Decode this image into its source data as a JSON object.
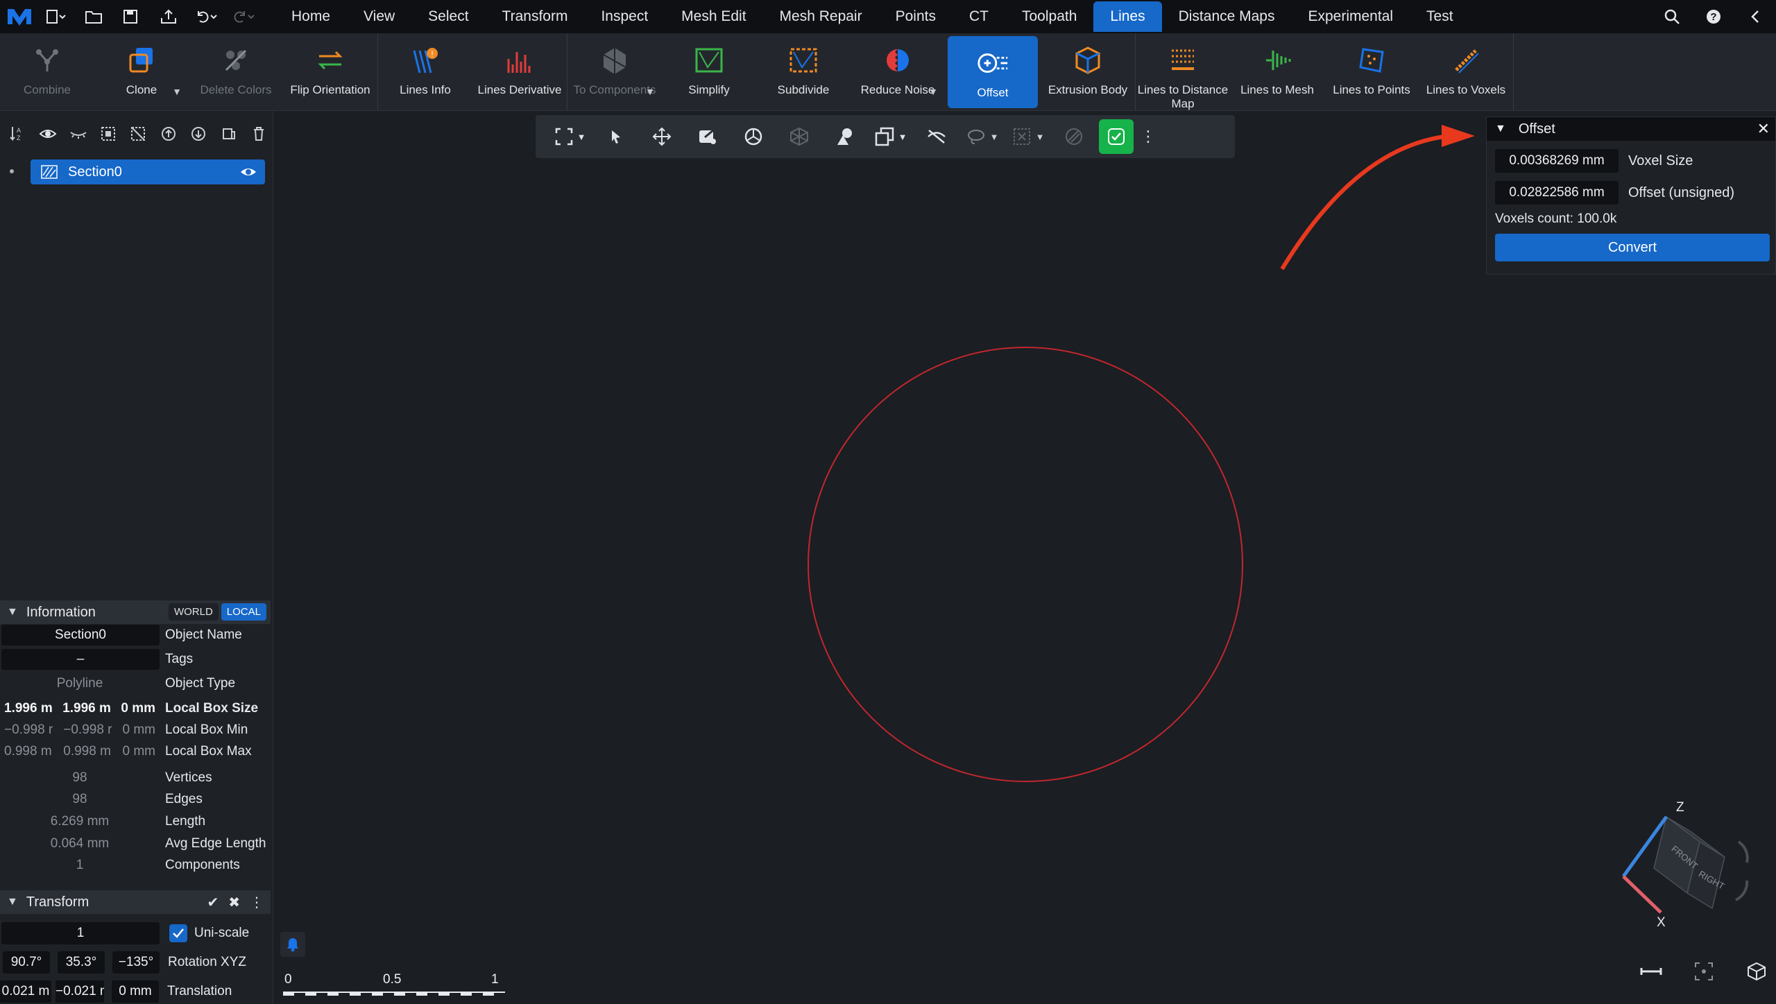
{
  "menu": {
    "tabs": [
      "Home",
      "View",
      "Select",
      "Transform",
      "Inspect",
      "Mesh Edit",
      "Mesh Repair",
      "Points",
      "CT",
      "Toolpath",
      "Lines",
      "Distance Maps",
      "Experimental",
      "Test"
    ],
    "active_tab": "Lines"
  },
  "ribbon": {
    "combine": "Combine",
    "clone": "Clone",
    "delete_colors": "Delete Colors",
    "flip_orientation": "Flip Orientation",
    "lines_info": "Lines Info",
    "lines_derivative": "Lines Derivative",
    "to_components": "To Components",
    "simplify": "Simplify",
    "subdivide": "Subdivide",
    "reduce_noise": "Reduce Noise",
    "offset": "Offset",
    "extrusion_body": "Extrusion Body",
    "lines_to_distance_map": "Lines to Distance Map",
    "lines_to_mesh": "Lines to Mesh",
    "lines_to_points": "Lines to Points",
    "lines_to_voxels": "Lines to Voxels"
  },
  "tree": {
    "items": [
      {
        "label": "Section0"
      }
    ]
  },
  "information": {
    "title": "Information",
    "world": "WORLD",
    "local": "LOCAL",
    "object_name_value": "Section0",
    "object_name_key": "Object Name",
    "tags_value": "–",
    "tags_key": "Tags",
    "object_type_value": "Polyline",
    "object_type_key": "Object Type",
    "box_size": [
      "1.996 m",
      "1.996 m",
      "0 mm"
    ],
    "box_size_key": "Local Box Size",
    "box_min": [
      "−0.998 r",
      "−0.998 r",
      "0 mm"
    ],
    "box_min_key": "Local Box Min",
    "box_max": [
      "0.998 m",
      "0.998 m",
      "0 mm"
    ],
    "box_max_key": "Local Box Max",
    "vertices_value": "98",
    "vertices_key": "Vertices",
    "edges_value": "98",
    "edges_key": "Edges",
    "length_value": "6.269 mm",
    "length_key": "Length",
    "avg_edge_value": "0.064 mm",
    "avg_edge_key": "Avg Edge Length",
    "components_value": "1",
    "components_key": "Components"
  },
  "transform": {
    "title": "Transform",
    "uniscale_value": "1",
    "uniscale_label": "Uni-scale",
    "rotation": [
      "90.7°",
      "35.3°",
      "−135°"
    ],
    "rotation_label": "Rotation XYZ",
    "translation": [
      "0.021 m",
      "−0.021 n",
      "0 mm"
    ],
    "translation_label": "Translation"
  },
  "offset_panel": {
    "title": "Offset",
    "voxel_size_value": "0.00368269 mm",
    "voxel_size_label": "Voxel Size",
    "offset_value": "0.02822586 mm",
    "offset_label": "Offset (unsigned)",
    "voxels_count": "Voxels count: 100.0k",
    "convert": "Convert"
  },
  "scale_bar": {
    "labels": [
      "0",
      "0.5",
      "1"
    ]
  },
  "view_cube": {
    "axis_z": "Z",
    "axis_x": "X",
    "face_front": "FRONT",
    "face_right": "RIGHT"
  },
  "colors": {
    "accent": "#1668c9",
    "curve": "#c1272d",
    "arrow": "#e8391e",
    "green": "#16b34a"
  }
}
